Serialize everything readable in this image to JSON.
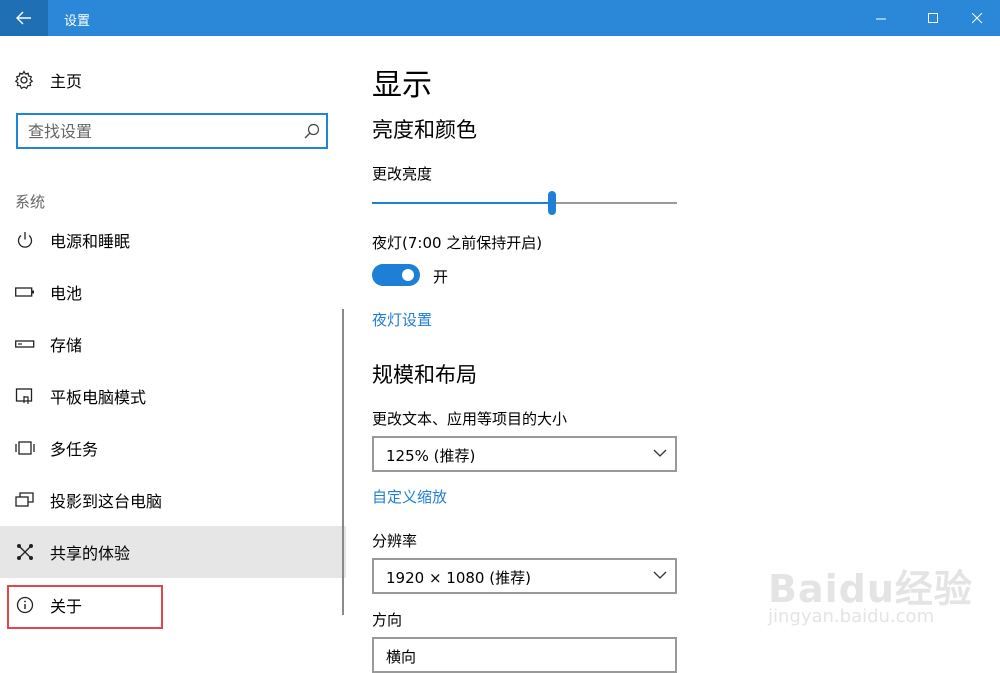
{
  "window": {
    "title": "设置"
  },
  "sidebar": {
    "home_label": "主页",
    "search_placeholder": "查找设置",
    "section_label": "系统",
    "items": [
      {
        "label": "电源和睡眠",
        "icon": "power-icon"
      },
      {
        "label": "电池",
        "icon": "battery-icon"
      },
      {
        "label": "存储",
        "icon": "storage-icon"
      },
      {
        "label": "平板电脑模式",
        "icon": "tablet-mode-icon"
      },
      {
        "label": "多任务",
        "icon": "multitasking-icon"
      },
      {
        "label": "投影到这台电脑",
        "icon": "project-icon"
      },
      {
        "label": "共享的体验",
        "icon": "shared-experiences-icon",
        "selected": true
      },
      {
        "label": "关于",
        "icon": "info-icon"
      }
    ]
  },
  "main": {
    "title": "显示",
    "brightness_section": "亮度和颜色",
    "brightness_label": "更改亮度",
    "brightness_level": 0.59,
    "night_light_label": "夜灯(7:00 之前保持开启)",
    "night_light_state": "开",
    "night_light_link": "夜灯设置",
    "scale_section": "规模和布局",
    "scale_label": "更改文本、应用等项目的大小",
    "scale_value": "125% (推荐)",
    "custom_scale_link": "自定义缩放",
    "resolution_label": "分辨率",
    "resolution_value": "1920 × 1080 (推荐)",
    "orientation_label": "方向",
    "orientation_value": "横向"
  },
  "watermark": {
    "logo": "Baidu经验",
    "url": "jingyan.baidu.com"
  },
  "colors": {
    "accent": "#1e7fd6",
    "titlebar": "#2b88d8",
    "selected_bg": "#e6e6e6",
    "highlight_border": "#e0474c"
  }
}
